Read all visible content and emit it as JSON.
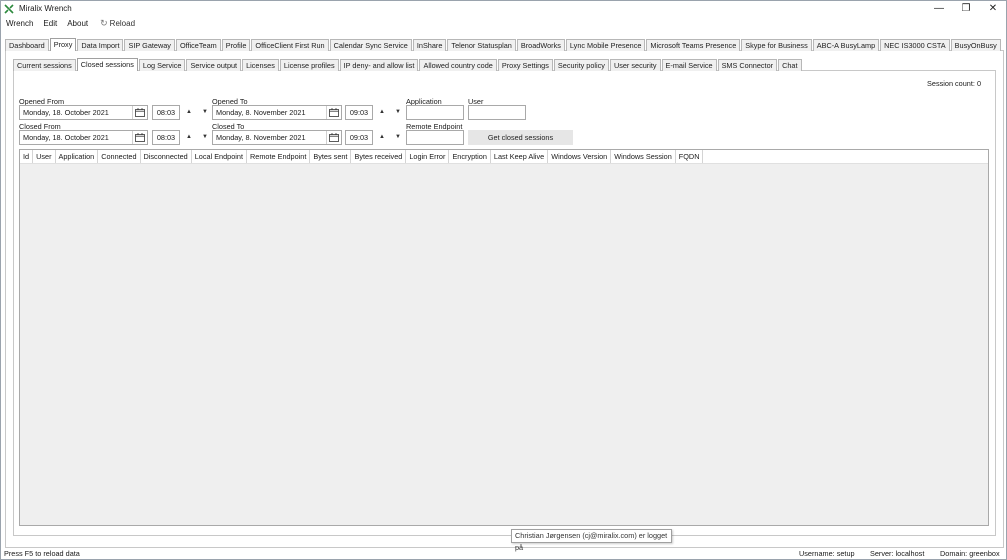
{
  "window": {
    "title": "Miralix Wrench",
    "controls": {
      "minimize": "—",
      "restore": "❐",
      "close": "✕"
    }
  },
  "menu": {
    "items": [
      "Wrench",
      "Edit",
      "About"
    ],
    "reload_label": "Reload",
    "reload_icon": "refresh-icon"
  },
  "main_tabs": [
    "Dashboard",
    "Proxy",
    "Data Import",
    "SIP Gateway",
    "OfficeTeam",
    "Profile",
    "OfficeClient First Run",
    "Calendar Sync Service",
    "InShare",
    "Telenor Statusplan",
    "BroadWorks",
    "Lync Mobile Presence",
    "Microsoft Teams Presence",
    "Skype for Business",
    "ABC-A BusyLamp",
    "NEC IS3000 CSTA",
    "BusyOnBusy"
  ],
  "main_active": "Proxy",
  "sub_tabs": [
    "Current sessions",
    "Closed sessions",
    "Log Service",
    "Service output",
    "Licenses",
    "License profiles",
    "IP deny- and allow list",
    "Allowed country code",
    "Proxy Settings",
    "Security policy",
    "User security",
    "E-mail Service",
    "SMS Connector",
    "Chat"
  ],
  "sub_active": "Closed sessions",
  "session_count": "Session count: 0",
  "filters": {
    "opened_from": {
      "label": "Opened From",
      "date": "Monday, 18. October 2021",
      "time": "08:03"
    },
    "opened_to": {
      "label": "Opened To",
      "date": "Monday, 8. November 2021",
      "time": "09:03"
    },
    "closed_from": {
      "label": "Closed From",
      "date": "Monday, 18. October 2021",
      "time": "08:03"
    },
    "closed_to": {
      "label": "Closed To",
      "date": "Monday, 8. November 2021",
      "time": "09:03"
    },
    "application": {
      "label": "Application",
      "value": ""
    },
    "user": {
      "label": "User",
      "value": ""
    },
    "remote_endpoint": {
      "label": "Remote Endpoint",
      "value": ""
    },
    "spin_up": "▲",
    "spin_down": "▼",
    "get_button": "Get closed sessions"
  },
  "grid": {
    "columns": [
      "Id",
      "User",
      "Application",
      "Connected",
      "Disconnected",
      "Local Endpoint",
      "Remote Endpoint",
      "Bytes sent",
      "Bytes received",
      "Login Error",
      "Encryption",
      "Last Keep Alive",
      "Windows Version",
      "Windows Session",
      "FQDN"
    ],
    "rows": []
  },
  "tooltip": "Christian Jørgensen (cj@miralix.com) er logget på",
  "status": {
    "left": "Press F5 to reload data",
    "username": "Username: setup",
    "server": "Server: localhost",
    "domain": "Domain: greenbox"
  }
}
